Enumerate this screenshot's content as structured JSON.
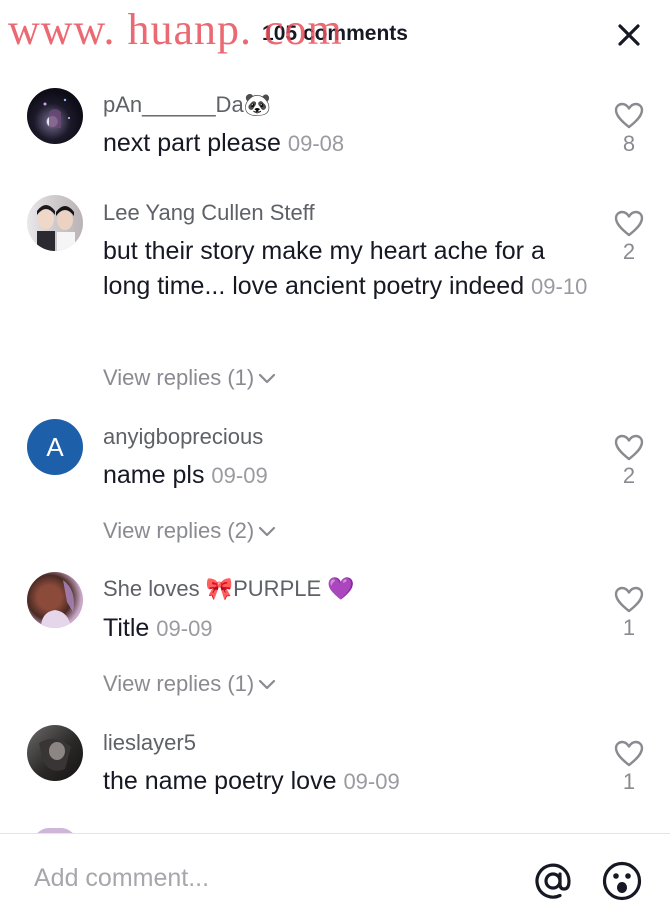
{
  "watermark": "www. huanp. com",
  "header": {
    "title": "105 comments"
  },
  "comments": [
    {
      "username": "pAn______Da🐼",
      "text": "next part please",
      "date": "09-08",
      "likes": "8"
    },
    {
      "username": "Lee Yang Cullen Steff",
      "text": "but their story make my heart ache for a long time... love ancient poetry indeed",
      "date": "09-10",
      "likes": "2",
      "replies": "View replies (1)"
    },
    {
      "username": "anyigboprecious",
      "avatar_letter": "A",
      "text": "name pls",
      "date": "09-09",
      "likes": "2",
      "replies": "View replies (2)"
    },
    {
      "username": "She loves 🎀PURPLE 💜",
      "text": "Title",
      "date": "09-09",
      "likes": "1",
      "replies": "View replies (1)"
    },
    {
      "username": "lieslayer5",
      "text": "the name poetry love",
      "date": "09-09",
      "likes": "1"
    }
  ],
  "composer": {
    "placeholder": "Add comment..."
  },
  "colors": {
    "accent": "#1d5fa8",
    "watermark": "#e8505b",
    "muted": "#8a8b91"
  },
  "icons": [
    "close-icon",
    "heart-outline-icon",
    "chevron-down-icon",
    "at-icon",
    "emoji-icon"
  ]
}
